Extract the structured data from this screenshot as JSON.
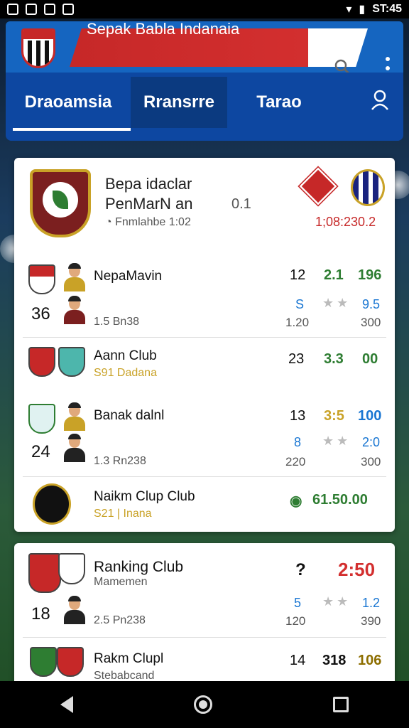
{
  "status_bar": {
    "time": "ST:45"
  },
  "app_bar": {
    "title": "Sepak Babla Indanaia"
  },
  "tabs": [
    {
      "label": "Draoamsia"
    },
    {
      "label": "Rransrre"
    },
    {
      "label": "Tarao"
    }
  ],
  "header": {
    "title_line1": "Bepa idaclar",
    "title_line2": "PenMarN an",
    "subtitle": "Fnmlahbe 1:02",
    "score": "0.1",
    "time": "1;08:230.2"
  },
  "rows": [
    {
      "name": "NepaMavin",
      "big": "36",
      "sub": "1.5 Bn38",
      "n1": "12",
      "n2": "2.1",
      "n3": "196",
      "s1": "S",
      "s2": "9.5",
      "s3": "1.20",
      "s4": "300"
    },
    {
      "name": "Aann Club",
      "sub": "S91 Dadana",
      "n1": "23",
      "n2": "3.3",
      "n3": "00"
    },
    {
      "name": "Banak dalnl",
      "big": "24",
      "sub": "1.3 Rn238",
      "n1": "13",
      "n2": "3:5",
      "n3": "100",
      "s1": "8",
      "s2": "2:0",
      "s3": "220",
      "s4": "300"
    },
    {
      "name": "Naikm Clup Club",
      "sub": "S21 | Inana",
      "amount": "61.50.00"
    }
  ],
  "card2_rows": [
    {
      "name": "Ranking Club",
      "sub1": "Mamemen",
      "big": "18",
      "sub": "2.5 Pn238",
      "n1": "?",
      "n2": "2:50",
      "s1": "5",
      "s2": "1.2",
      "s3": "120",
      "s4": "390"
    },
    {
      "name": "Rakm Clupl",
      "sub1": "Stebabcand",
      "n1": "14",
      "n2": "318",
      "n3": "106"
    }
  ],
  "stars": "★★",
  "colors": {
    "primary": "#1565c0",
    "accent_red": "#d32f2f",
    "green": "#2e7d32",
    "blue": "#1976d2"
  }
}
